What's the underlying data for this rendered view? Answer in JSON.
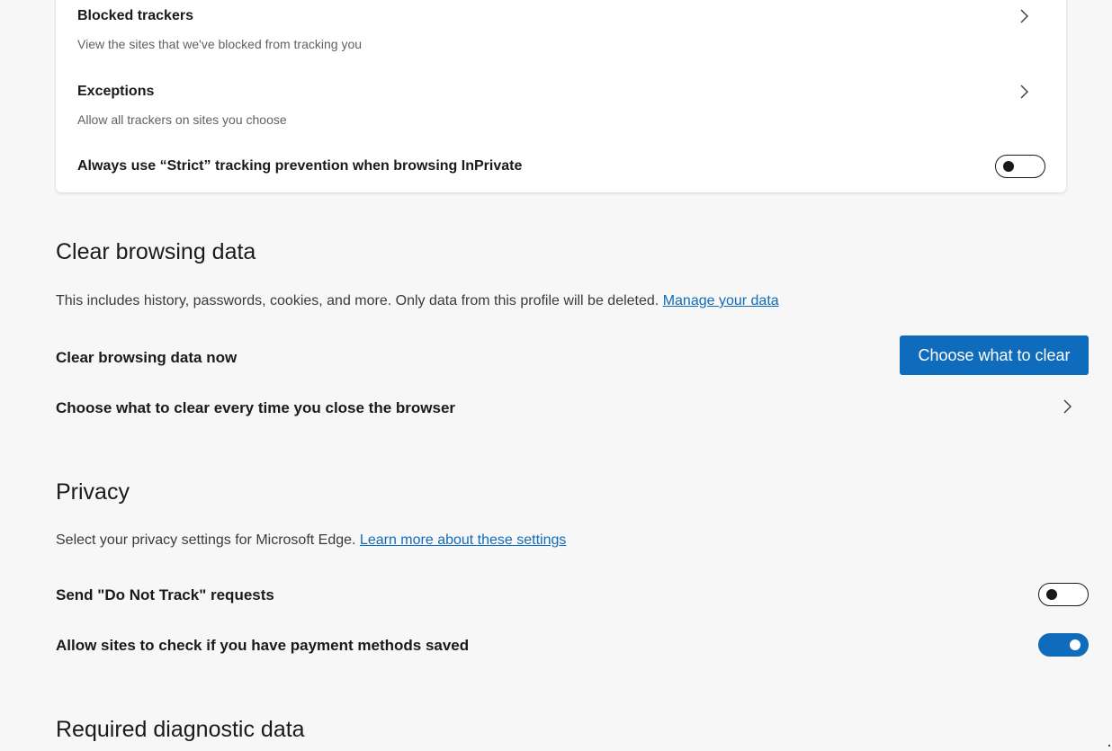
{
  "tracking_card": {
    "blocked_trackers": {
      "title": "Blocked trackers",
      "subtitle": "View the sites that we've blocked from tracking you"
    },
    "exceptions": {
      "title": "Exceptions",
      "subtitle": "Allow all trackers on sites you choose"
    },
    "strict_inprivate": {
      "label": "Always use “Strict” tracking prevention when browsing InPrivate",
      "enabled": false
    }
  },
  "clear_browsing": {
    "heading": "Clear browsing data",
    "description": "This includes history, passwords, cookies, and more. Only data from this profile will be deleted.",
    "link": "Manage your data",
    "now_label": "Clear browsing data now",
    "button_label": "Choose what to clear",
    "on_close_label": "Choose what to clear every time you close the browser"
  },
  "privacy": {
    "heading": "Privacy",
    "description": "Select your privacy settings for Microsoft Edge.",
    "link": "Learn more about these settings",
    "do_not_track": {
      "label": "Send \"Do Not Track\" requests",
      "enabled": false
    },
    "payment_methods": {
      "label": "Allow sites to check if you have payment methods saved",
      "enabled": true
    }
  },
  "diagnostic": {
    "heading": "Required diagnostic data"
  },
  "colors": {
    "accent": "#0f6cbd",
    "page_background": "#f7f7f7",
    "card_background": "#ffffff"
  },
  "icons": {
    "chevron": "chevron-right-icon"
  }
}
